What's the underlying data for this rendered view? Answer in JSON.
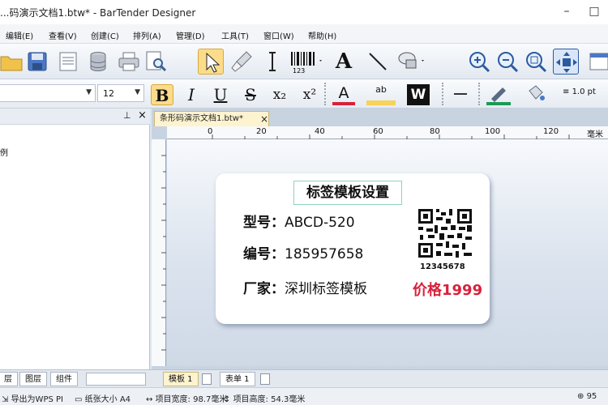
{
  "window": {
    "title": "...码演示文档1.btw* - BarTender Designer",
    "minimize": "–",
    "maximize": "□"
  },
  "menu": [
    "编辑(E)",
    "查看(V)",
    "创建(C)",
    "排列(A)",
    "管理(D)",
    "工具(T)",
    "窗口(W)",
    "帮助(H)"
  ],
  "toolbar": {
    "barcode_digits": "123",
    "text_tool": "A"
  },
  "format": {
    "font_size": "12",
    "bold": "B",
    "italic": "I",
    "underline": "U",
    "strike": "S",
    "subscript": "x₂",
    "superscript": "x²",
    "font_color": "A",
    "highlight_label": "ab",
    "black_bg": "W",
    "line_width": "1.0 pt"
  },
  "left_panel": {
    "pin": "⊥",
    "close": "×",
    "tree_item": "例",
    "tabs": [
      "层",
      "图层",
      "组件"
    ]
  },
  "document": {
    "tab": "条形码演示文档1.btw*",
    "tab_close": "×",
    "ruler_labels": [
      "0",
      "20",
      "40",
      "60",
      "80",
      "100",
      "120",
      "毫米"
    ],
    "label": {
      "title": "标签模板设置",
      "rows": [
        {
          "key": "型号：",
          "value": "ABCD-520"
        },
        {
          "key": "编号：",
          "value": "185957658"
        },
        {
          "key": "厂家：",
          "value": "深圳标签模板"
        }
      ],
      "qr_text": "12345678",
      "price": "价格1999"
    },
    "page_tabs": [
      "模板 1",
      "表单 1"
    ]
  },
  "status": {
    "export": "导出为WPS PI",
    "paper": "纸张大小 A4",
    "width": "项目宽度: 98.7毫米",
    "height": "项目高度: 54.3毫米",
    "zoom": "95"
  },
  "colors": {
    "accent_red": "#d8213b",
    "qr_frame": "#8fd3c0",
    "highlight_yellow": "#f6d35a"
  }
}
